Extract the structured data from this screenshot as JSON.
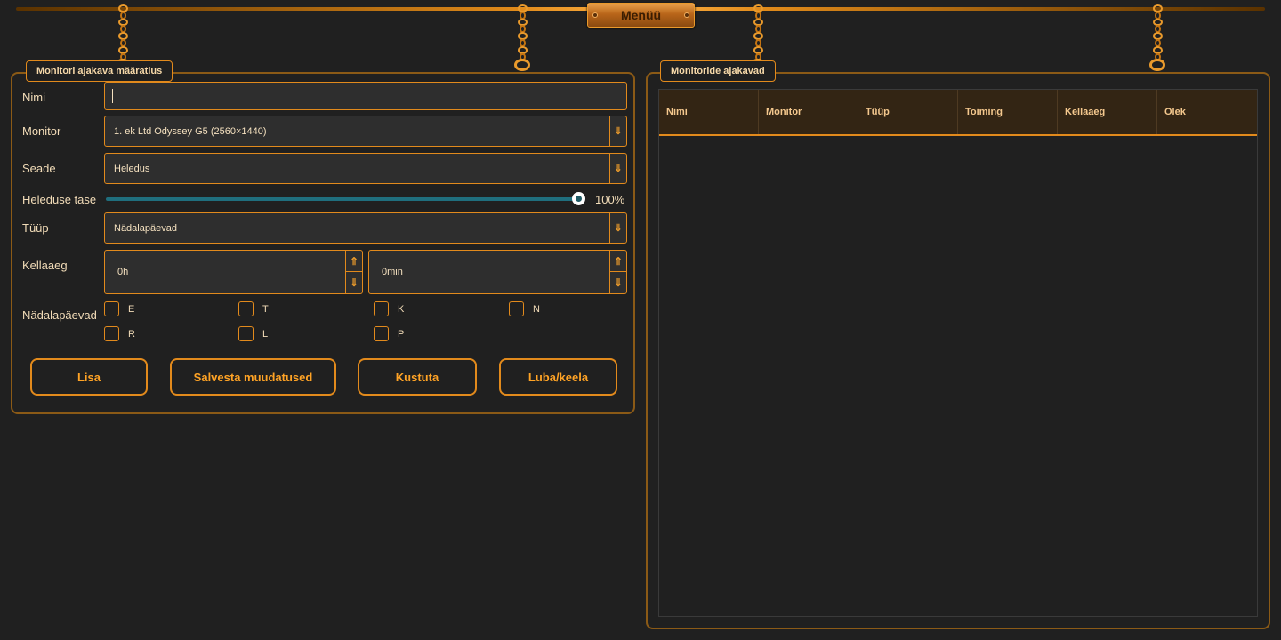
{
  "top_bar": {
    "menu_label": "Menüü"
  },
  "schedule_form": {
    "title": "Monitori ajakava määratlus",
    "name": {
      "label": "Nimi",
      "value": ""
    },
    "monitor": {
      "label": "Monitor",
      "value": "1. ek Ltd Odyssey G5 (2560×1440)"
    },
    "setting": {
      "label": "Seade",
      "value": "Heledus"
    },
    "brightness": {
      "label": "Heleduse tase",
      "value_text": "100%",
      "value": 100
    },
    "type": {
      "label": "Tüüp",
      "value": "Nädalapäevad"
    },
    "time": {
      "label": "Kellaaeg",
      "hours": "0h",
      "minutes": "0min"
    },
    "weekdays": {
      "label": "Nädalapäevad",
      "days": [
        "E",
        "T",
        "K",
        "N",
        "R",
        "L",
        "P"
      ]
    },
    "buttons": {
      "add": "Lisa",
      "save": "Salvesta muudatused",
      "delete": "Kustuta",
      "toggle": "Luba/keela"
    }
  },
  "schedules_table": {
    "title": "Monitoride ajakavad",
    "columns": [
      "Nimi",
      "Monitor",
      "Tüüp",
      "Toiming",
      "Kellaaeg",
      "Olek"
    ],
    "rows": []
  },
  "icons": {
    "dropdown": "chevron-down-icon",
    "spin_up": "arrow-up-icon",
    "spin_down": "arrow-down-icon"
  },
  "colors": {
    "background": "#202020",
    "accent": "#e28a1c",
    "accent_text": "#ffa325",
    "slider": "#1f6e7d"
  }
}
